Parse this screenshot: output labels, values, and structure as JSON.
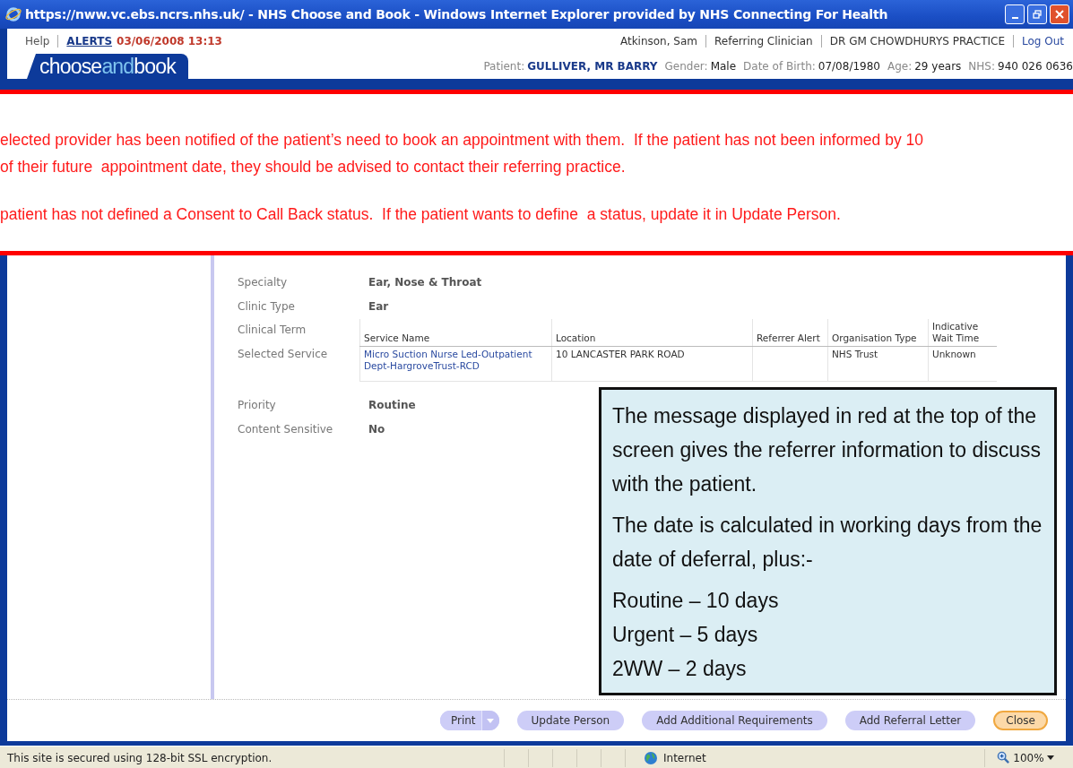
{
  "window": {
    "title": "https://nww.vc.ebs.ncrs.nhs.uk/ - NHS Choose and Book - Windows Internet Explorer provided by NHS Connecting For Health"
  },
  "top_links": {
    "help": "Help",
    "alerts": "ALERTS",
    "alert_time": "03/06/2008 13:13",
    "user": "Atkinson, Sam",
    "role": "Referring Clinician",
    "practice": "DR GM CHOWDHURYS PRACTICE",
    "logout": "Log Out"
  },
  "logo": [
    "choose",
    "and",
    "book"
  ],
  "patient": [
    {
      "label": "Patient:",
      "value": "GULLIVER, MR BARRY"
    },
    {
      "label": "Gender:",
      "value": "Male"
    },
    {
      "label": "Date of Birth:",
      "value": "07/08/1980"
    },
    {
      "label": "Age:",
      "value": "29 years"
    },
    {
      "label": "NHS:",
      "value": "940 026 0636"
    }
  ],
  "banner": {
    "paragraphs": [
      [
        "elected provider has been notified of the patient’s need to book an appointment with them.  If the patient has not been informed by 10",
        "of their future  appointment date, they should be advised to contact their referring practice."
      ],
      [
        "patient has not defined a Consent to Call Back status.  If the patient wants to define  a status, update it in Update Person."
      ]
    ]
  },
  "details_top": [
    {
      "label": "Specialty",
      "value": "Ear, Nose & Throat"
    },
    {
      "label": "Clinic Type",
      "value": "Ear"
    }
  ],
  "service": {
    "labels": [
      "Clinical Term",
      "Selected Service"
    ],
    "columns": [
      "Service Name",
      "Location",
      "Referrer Alert",
      "Organisation Type",
      "Indicative Wait Time"
    ],
    "rows": [
      [
        "Micro Suction Nurse Led-Outpatient Dept-HargroveTrust-RCD",
        "10 LANCASTER PARK ROAD",
        "",
        "NHS Trust",
        "Unknown"
      ]
    ]
  },
  "details_bottom": [
    {
      "label": "Priority",
      "value": "Routine"
    },
    {
      "label": "Content Sensitive",
      "value": "No"
    }
  ],
  "callout": {
    "paragraphs": [
      "The message displayed in red at the top of the screen gives the referrer information to discuss with the patient.",
      "The date is calculated in working days from the date of deferral, plus:-"
    ],
    "lines": [
      "Routine – 10 days",
      "Urgent – 5 days",
      "2WW – 2 days"
    ]
  },
  "buttons": [
    {
      "label": "Print",
      "kind": "dropdown"
    },
    {
      "label": "Update Person",
      "kind": "plain"
    },
    {
      "label": "Add Additional Requirements",
      "kind": "plain"
    },
    {
      "label": "Add Referral Letter",
      "kind": "plain"
    },
    {
      "label": "Close",
      "kind": "primary"
    }
  ],
  "status_bar": {
    "message": "This site is secured using 128-bit SSL encryption.",
    "zone": "Internet",
    "zoom": "100%"
  }
}
